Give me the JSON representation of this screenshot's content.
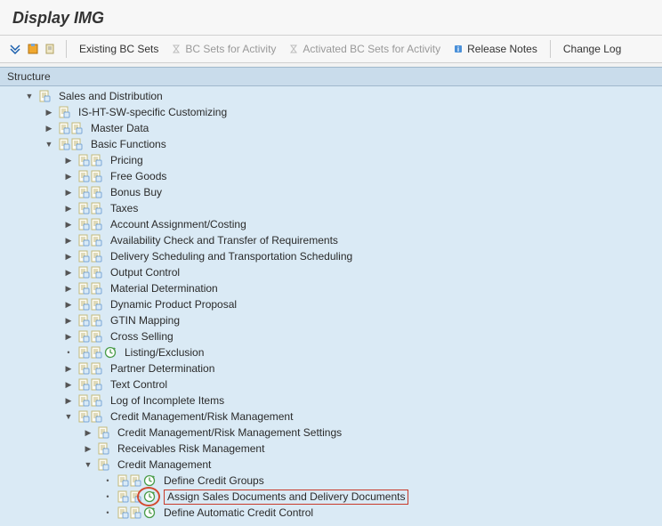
{
  "title": "Display IMG",
  "toolbar": {
    "existing_bc": "Existing BC Sets",
    "bc_for_activity": "BC Sets for Activity",
    "activated_bc": "Activated BC Sets for Activity",
    "release_notes": "Release Notes",
    "change_log": "Change Log"
  },
  "structure_label": "Structure",
  "tree": [
    {
      "indent": 1,
      "toggle": "open",
      "icons": [
        "doc"
      ],
      "label": "Sales and Distribution"
    },
    {
      "indent": 2,
      "toggle": "closed",
      "icons": [
        "doc"
      ],
      "label": "IS-HT-SW-specific Customizing"
    },
    {
      "indent": 2,
      "toggle": "closed",
      "icons": [
        "doc",
        "doc"
      ],
      "label": "Master Data"
    },
    {
      "indent": 2,
      "toggle": "open",
      "icons": [
        "doc",
        "doc"
      ],
      "label": "Basic Functions"
    },
    {
      "indent": 3,
      "toggle": "closed",
      "icons": [
        "doc",
        "doc"
      ],
      "label": "Pricing"
    },
    {
      "indent": 3,
      "toggle": "closed",
      "icons": [
        "doc",
        "doc"
      ],
      "label": "Free Goods"
    },
    {
      "indent": 3,
      "toggle": "closed",
      "icons": [
        "doc",
        "doc"
      ],
      "label": "Bonus Buy"
    },
    {
      "indent": 3,
      "toggle": "closed",
      "icons": [
        "doc",
        "doc"
      ],
      "label": "Taxes"
    },
    {
      "indent": 3,
      "toggle": "closed",
      "icons": [
        "doc",
        "doc"
      ],
      "label": "Account Assignment/Costing"
    },
    {
      "indent": 3,
      "toggle": "closed",
      "icons": [
        "doc",
        "doc"
      ],
      "label": "Availability Check and Transfer of Requirements"
    },
    {
      "indent": 3,
      "toggle": "closed",
      "icons": [
        "doc",
        "doc"
      ],
      "label": "Delivery Scheduling and Transportation Scheduling"
    },
    {
      "indent": 3,
      "toggle": "closed",
      "icons": [
        "doc",
        "doc"
      ],
      "label": "Output Control"
    },
    {
      "indent": 3,
      "toggle": "closed",
      "icons": [
        "doc",
        "doc"
      ],
      "label": "Material Determination"
    },
    {
      "indent": 3,
      "toggle": "closed",
      "icons": [
        "doc",
        "doc"
      ],
      "label": "Dynamic Product Proposal"
    },
    {
      "indent": 3,
      "toggle": "closed",
      "icons": [
        "doc",
        "doc"
      ],
      "label": "GTIN Mapping"
    },
    {
      "indent": 3,
      "toggle": "closed",
      "icons": [
        "doc",
        "doc"
      ],
      "label": "Cross Selling"
    },
    {
      "indent": 3,
      "toggle": "leaf",
      "icons": [
        "doc",
        "doc",
        "clock"
      ],
      "label": "Listing/Exclusion"
    },
    {
      "indent": 3,
      "toggle": "closed",
      "icons": [
        "doc",
        "doc"
      ],
      "label": "Partner Determination"
    },
    {
      "indent": 3,
      "toggle": "closed",
      "icons": [
        "doc",
        "doc"
      ],
      "label": "Text Control"
    },
    {
      "indent": 3,
      "toggle": "closed",
      "icons": [
        "doc",
        "doc"
      ],
      "label": "Log of Incomplete Items"
    },
    {
      "indent": 3,
      "toggle": "open",
      "icons": [
        "doc",
        "doc"
      ],
      "label": "Credit Management/Risk Management"
    },
    {
      "indent": 4,
      "toggle": "closed",
      "icons": [
        "doc"
      ],
      "label": "Credit Management/Risk Management Settings"
    },
    {
      "indent": 4,
      "toggle": "closed",
      "icons": [
        "doc"
      ],
      "label": "Receivables Risk Management"
    },
    {
      "indent": 4,
      "toggle": "open",
      "icons": [
        "doc"
      ],
      "label": "Credit Management"
    },
    {
      "indent": 5,
      "toggle": "leaf",
      "icons": [
        "doc",
        "doc",
        "clock"
      ],
      "label": "Define Credit Groups"
    },
    {
      "indent": 5,
      "toggle": "leaf",
      "icons": [
        "doc",
        "doc",
        "clock"
      ],
      "label": "Assign Sales Documents and Delivery Documents",
      "boxed": true,
      "circled": true
    },
    {
      "indent": 5,
      "toggle": "leaf",
      "icons": [
        "doc",
        "doc",
        "clock"
      ],
      "label": "Define Automatic Credit Control"
    }
  ]
}
